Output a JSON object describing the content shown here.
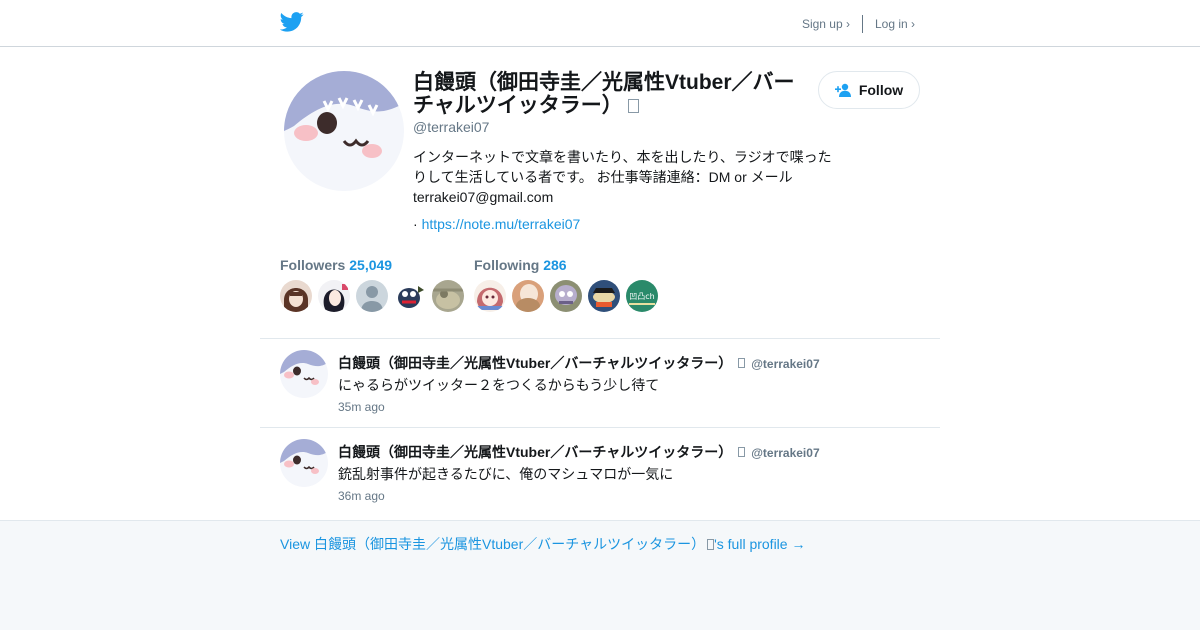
{
  "topbar": {
    "logo_icon": "twitter-bird-icon",
    "brand_color": "#1da1f2",
    "signup_label": "Sign up ›",
    "login_label": "Log in ›"
  },
  "profile": {
    "display_name": "白饅頭（御田寺圭／光属性Vtuber／バーチャルツイッタラー）",
    "handle": "@terrakei07",
    "bio": "インターネットで文章を書いたり、本を出したり、ラジオで喋ったりして生活している者です。 お仕事等諸連絡：DM or メール terrakei07@gmail.com",
    "url_prefix": "·",
    "url": "https://note.mu/terrakei07",
    "follow_label": "Follow",
    "follow_icon": "add-user-icon",
    "followers_label": "Followers",
    "followers_count": "25,049",
    "following_label": "Following",
    "following_count": "286",
    "follower_avatars": [
      {
        "icon": "user-avatar",
        "color": "#8a5a44"
      },
      {
        "icon": "user-avatar",
        "color": "#1c1c2a"
      },
      {
        "icon": "default-avatar-icon",
        "color": "#9aa5b1"
      },
      {
        "icon": "user-avatar",
        "color": "#2a3b5a"
      },
      {
        "icon": "user-avatar",
        "color": "#9c9c86"
      }
    ],
    "following_avatars": [
      {
        "icon": "user-avatar",
        "color": "#c87f84"
      },
      {
        "icon": "user-avatar",
        "color": "#c89a74"
      },
      {
        "icon": "user-avatar",
        "color": "#a398b8"
      },
      {
        "icon": "user-avatar",
        "color": "#2f4f7a"
      },
      {
        "icon": "user-avatar",
        "color": "#2a8a6a",
        "text": "凹凸ch"
      }
    ]
  },
  "tweets": [
    {
      "name": "白饅頭（御田寺圭／光属性Vtuber／バーチャルツイッタラー）",
      "handle": "@terrakei07",
      "text": "にゃるらがツイッター２をつくるからもう少し待て",
      "time": "35m ago"
    },
    {
      "name": "白饅頭（御田寺圭／光属性Vtuber／バーチャルツイッタラー）",
      "handle": "@terrakei07",
      "text": "銃乱射事件が起きるたびに、俺のマシュマロが一気に",
      "time": "36m ago"
    }
  ],
  "footer": {
    "prefix": "View ",
    "name": "白饅頭（御田寺圭／光属性Vtuber／バーチャルツイッタラー）",
    "suffix": "'s full profile →"
  }
}
